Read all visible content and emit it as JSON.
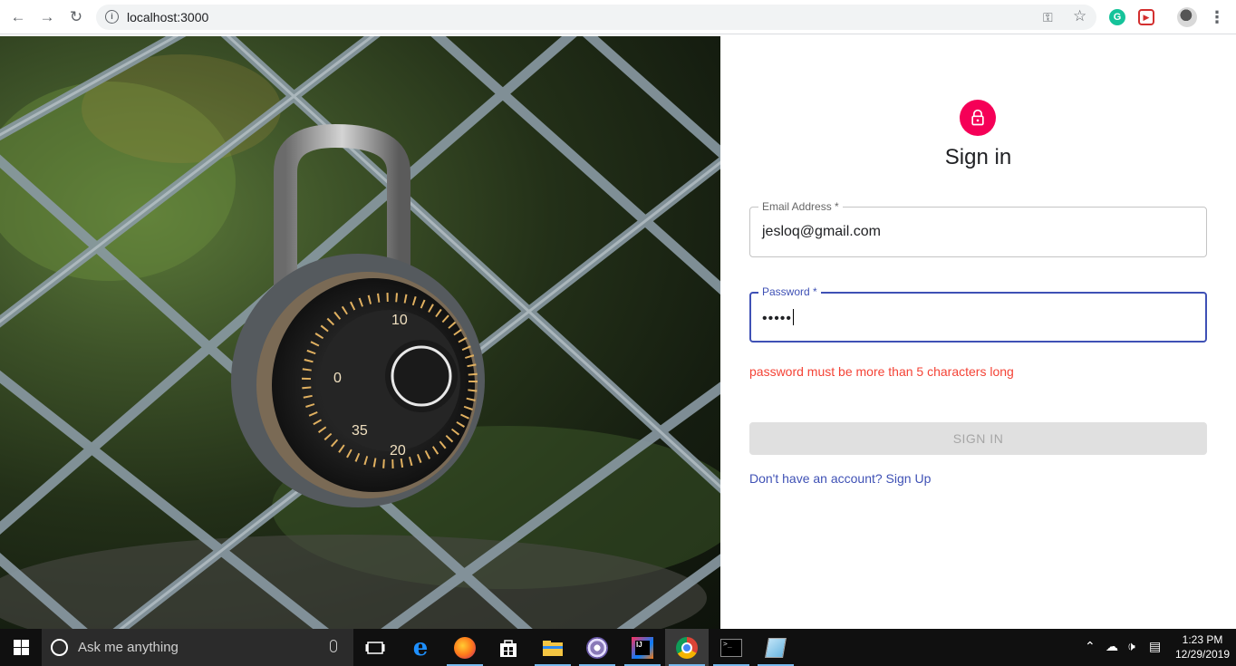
{
  "browser": {
    "url": "localhost:3000",
    "icons": [
      "back-arrow-icon",
      "forward-arrow-icon",
      "reload-icon",
      "info-icon",
      "key-icon",
      "star-icon",
      "grammarly-icon",
      "extension-icon",
      "profile-avatar",
      "menu-icon"
    ]
  },
  "form": {
    "title": "Sign in",
    "email": {
      "label": "Email Address *",
      "value": "jesloq@gmail.com"
    },
    "password": {
      "label": "Password *",
      "value": "•••••"
    },
    "error": "password must be more than 5 characters long",
    "submit_label": "SIGN IN",
    "signup_link": "Don't have an account? Sign Up",
    "colors": {
      "avatar": "#f50057",
      "primary": "#3f51b5",
      "error": "#f44336",
      "disabled_bg": "#e0e0e0"
    }
  },
  "taskbar": {
    "search_placeholder": "Ask me anything",
    "time": "1:23 PM",
    "date": "12/29/2019",
    "apps": [
      "task-view",
      "edge",
      "firefox",
      "store",
      "file-explorer",
      "app-swirl",
      "intellij",
      "chrome",
      "terminal",
      "notepad"
    ]
  }
}
